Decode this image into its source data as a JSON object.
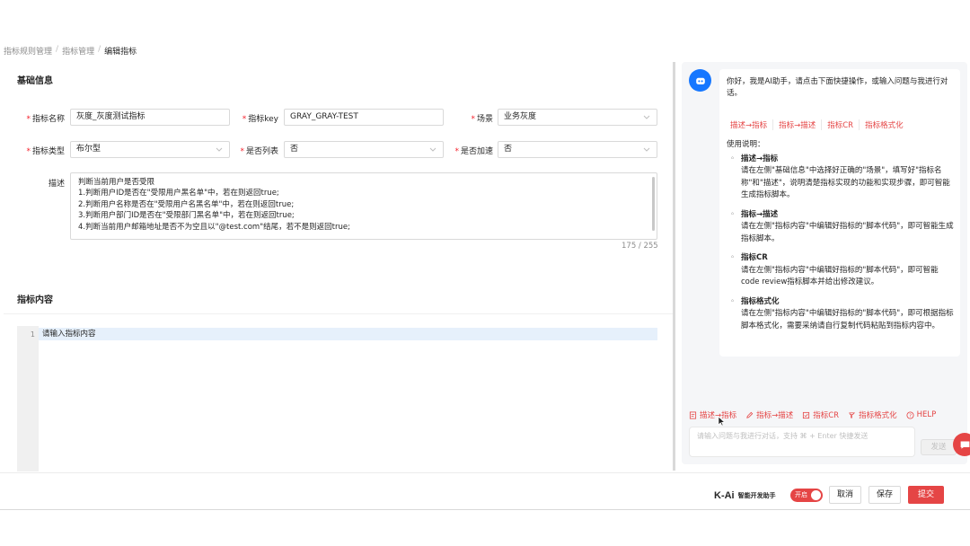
{
  "breadcrumb": [
    "指标规则管理",
    "指标管理",
    "编辑指标"
  ],
  "basic": {
    "title": "基础信息",
    "fields": {
      "name": {
        "label": "指标名称",
        "value": "灰度_灰度测试指标"
      },
      "key": {
        "label": "指标key",
        "value": "GRAY_GRAY-TEST"
      },
      "scene": {
        "label": "场景",
        "value": "业务灰度"
      },
      "type": {
        "label": "指标类型",
        "value": "布尔型"
      },
      "is_list": {
        "label": "是否列表",
        "value": "否"
      },
      "encrypt": {
        "label": "是否加速",
        "value": "否"
      },
      "desc": {
        "label": "描述",
        "lines": [
          "判断当前用户是否受限",
          "1.判断用户ID是否在\"受限用户黑名单\"中，若在则返回true;",
          "2.判断用户名称是否在\"受限用户名黑名单\"中，若在则返回true;",
          "3.判断用户部门ID是否在\"受限部门黑名单\"中，若在则返回true;",
          "4.判断当前用户邮箱地址是否不为空且以\"@test.com\"结尾，若不是则返回true;"
        ],
        "counter": "175 / 255"
      }
    }
  },
  "content": {
    "title": "指标内容",
    "line_number": "1",
    "placeholder": "请输入指标内容"
  },
  "ai": {
    "greeting": "你好，我是AI助手，请点击下面快捷操作，或输入问题与我进行对话。",
    "quick_links": [
      "描述→指标",
      "指标→描述",
      "指标CR",
      "指标格式化"
    ],
    "usage_title": "使用说明：",
    "usage": [
      {
        "title": "描述→指标",
        "desc": "请在左侧\"基础信息\"中选择好正确的\"场景\"，填写好\"指标名称\"和\"描述\"，说明清楚指标实现的功能和实现步骤，即可智能生成指标脚本。"
      },
      {
        "title": "指标→描述",
        "desc": "请在左侧\"指标内容\"中编辑好指标的\"脚本代码\"，即可智能生成指标脚本。"
      },
      {
        "title": "指标CR",
        "desc": "请在左侧\"指标内容\"中编辑好指标的\"脚本代码\"，即可智能code review指标脚本并给出修改建议。"
      },
      {
        "title": "指标格式化",
        "desc": "请在左侧\"指标内容\"中编辑好指标的\"脚本代码\"，即可根据指标脚本格式化，需要采纳请自行复制代码粘贴到指标内容中。"
      }
    ],
    "toolbar": [
      "描述→指标",
      "指标→描述",
      "指标CR",
      "指标格式化",
      "HELP"
    ],
    "input_placeholder": "请输入问题与我进行对话，支持 ⌘ + Enter 快捷发送",
    "send_label": "发送",
    "accent": "#e54545"
  },
  "footer": {
    "logo_mark": "K-Ai",
    "logo_name": "智能开发助手",
    "toggle_label": "开启",
    "cancel": "取消",
    "save": "保存",
    "submit": "提交"
  }
}
